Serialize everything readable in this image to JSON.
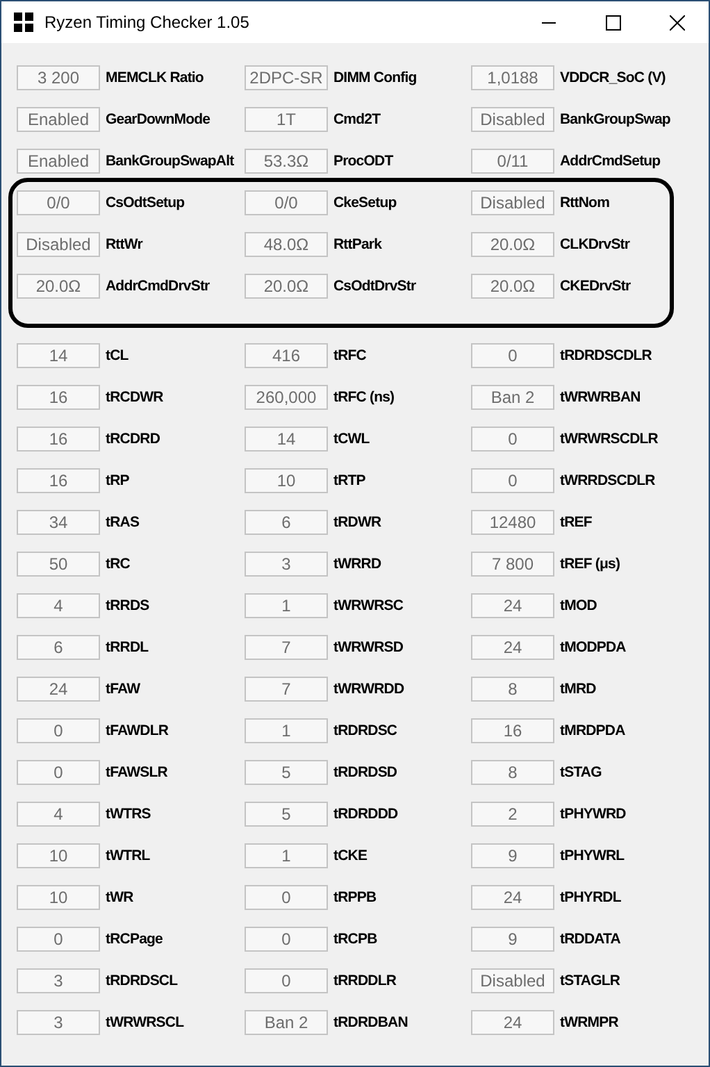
{
  "window": {
    "title": "Ryzen Timing Checker 1.05"
  },
  "sections": [
    {
      "highlighted": false,
      "rows": [
        [
          {
            "value": "3 200",
            "label": "MEMCLK Ratio"
          },
          {
            "value": "2DPC-SR",
            "label": "DIMM Config"
          },
          {
            "value": "1,0188",
            "label": "VDDCR_SoC (V)"
          }
        ],
        [
          {
            "value": "Enabled",
            "label": "GearDownMode"
          },
          {
            "value": "1T",
            "label": "Cmd2T"
          },
          {
            "value": "Disabled",
            "label": "BankGroupSwap"
          }
        ],
        [
          {
            "value": "Enabled",
            "label": "BankGroupSwapAlt"
          },
          {
            "value": "53.3Ω",
            "label": "ProcODT"
          },
          {
            "value": "0/11",
            "label": "AddrCmdSetup"
          }
        ]
      ]
    },
    {
      "highlighted": true,
      "rows": [
        [
          {
            "value": "0/0",
            "label": "CsOdtSetup"
          },
          {
            "value": "0/0",
            "label": "CkeSetup"
          },
          {
            "value": "Disabled",
            "label": "RttNom"
          }
        ],
        [
          {
            "value": "Disabled",
            "label": "RttWr"
          },
          {
            "value": "48.0Ω",
            "label": "RttPark"
          },
          {
            "value": "20.0Ω",
            "label": "CLKDrvStr"
          }
        ],
        [
          {
            "value": "20.0Ω",
            "label": "AddrCmdDrvStr"
          },
          {
            "value": "20.0Ω",
            "label": "CsOdtDrvStr"
          },
          {
            "value": "20.0Ω",
            "label": "CKEDrvStr"
          }
        ]
      ]
    },
    {
      "highlighted": false,
      "rows": [
        [
          {
            "value": "14",
            "label": "tCL"
          },
          {
            "value": "416",
            "label": "tRFC"
          },
          {
            "value": "0",
            "label": "tRDRDSCDLR"
          }
        ],
        [
          {
            "value": "16",
            "label": "tRCDWR"
          },
          {
            "value": "260,000",
            "label": "tRFC (ns)"
          },
          {
            "value": "Ban 2",
            "label": "tWRWRBAN"
          }
        ],
        [
          {
            "value": "16",
            "label": "tRCDRD"
          },
          {
            "value": "14",
            "label": "tCWL"
          },
          {
            "value": "0",
            "label": "tWRWRSCDLR"
          }
        ],
        [
          {
            "value": "16",
            "label": "tRP"
          },
          {
            "value": "10",
            "label": "tRTP"
          },
          {
            "value": "0",
            "label": "tWRRDSCDLR"
          }
        ],
        [
          {
            "value": "34",
            "label": "tRAS"
          },
          {
            "value": "6",
            "label": "tRDWR"
          },
          {
            "value": "12480",
            "label": "tREF"
          }
        ],
        [
          {
            "value": "50",
            "label": "tRC"
          },
          {
            "value": "3",
            "label": "tWRRD"
          },
          {
            "value": "7 800",
            "label": "tREF (μs)"
          }
        ],
        [
          {
            "value": "4",
            "label": "tRRDS"
          },
          {
            "value": "1",
            "label": "tWRWRSC"
          },
          {
            "value": "24",
            "label": "tMOD"
          }
        ],
        [
          {
            "value": "6",
            "label": "tRRDL"
          },
          {
            "value": "7",
            "label": "tWRWRSD"
          },
          {
            "value": "24",
            "label": "tMODPDA"
          }
        ],
        [
          {
            "value": "24",
            "label": "tFAW"
          },
          {
            "value": "7",
            "label": "tWRWRDD"
          },
          {
            "value": "8",
            "label": "tMRD"
          }
        ],
        [
          {
            "value": "0",
            "label": "tFAWDLR"
          },
          {
            "value": "1",
            "label": "tRDRDSC"
          },
          {
            "value": "16",
            "label": "tMRDPDA"
          }
        ],
        [
          {
            "value": "0",
            "label": "tFAWSLR"
          },
          {
            "value": "5",
            "label": "tRDRDSD"
          },
          {
            "value": "8",
            "label": "tSTAG"
          }
        ],
        [
          {
            "value": "4",
            "label": "tWTRS"
          },
          {
            "value": "5",
            "label": "tRDRDDD"
          },
          {
            "value": "2",
            "label": "tPHYWRD"
          }
        ],
        [
          {
            "value": "10",
            "label": "tWTRL"
          },
          {
            "value": "1",
            "label": "tCKE"
          },
          {
            "value": "9",
            "label": "tPHYWRL"
          }
        ],
        [
          {
            "value": "10",
            "label": "tWR"
          },
          {
            "value": "0",
            "label": "tRPPB"
          },
          {
            "value": "24",
            "label": "tPHYRDL"
          }
        ],
        [
          {
            "value": "0",
            "label": "tRCPage"
          },
          {
            "value": "0",
            "label": "tRCPB"
          },
          {
            "value": "9",
            "label": "tRDDATA"
          }
        ],
        [
          {
            "value": "3",
            "label": "tRDRDSCL"
          },
          {
            "value": "0",
            "label": "tRRDDLR"
          },
          {
            "value": "Disabled",
            "label": "tSTAGLR"
          }
        ],
        [
          {
            "value": "3",
            "label": "tWRWRSCL"
          },
          {
            "value": "Ban 2",
            "label": "tRDRDBAN"
          },
          {
            "value": "24",
            "label": "tWRMPR"
          }
        ]
      ]
    }
  ]
}
